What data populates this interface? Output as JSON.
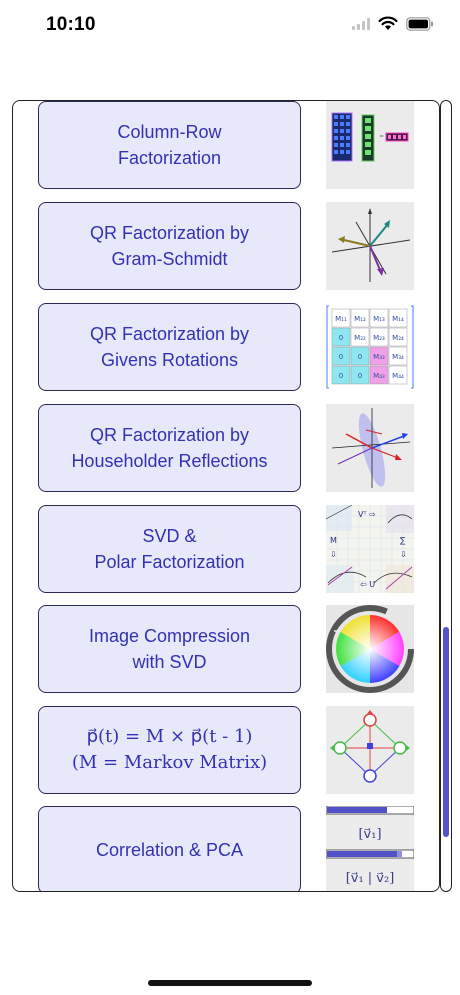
{
  "status_bar": {
    "time": "10:10"
  },
  "items": [
    {
      "label": "Column-Row\nFactorization",
      "icon": "column-row-matrix-icon"
    },
    {
      "label": "QR Factorization by\nGram-Schmidt",
      "icon": "orthogonal-vectors-icon"
    },
    {
      "label": "QR Factorization by\nGivens Rotations",
      "icon": "givens-matrix-icon",
      "matrix": [
        [
          "M₁₁",
          "M₁₂",
          "M₁₃",
          "M₁₄"
        ],
        [
          "0",
          "M₂₂",
          "M₂₃",
          "M₂₄"
        ],
        [
          "0",
          "0",
          "M₃₃",
          "M₃₄"
        ],
        [
          "0",
          "0",
          "M₄₃",
          "M₄₄"
        ]
      ]
    },
    {
      "label": "QR Factorization by\nHouseholder Reflections",
      "icon": "householder-reflection-icon"
    },
    {
      "label": "SVD &\nPolar Factorization",
      "icon": "svd-diagram-icon",
      "labels": {
        "vt": "Vᵀ ⇨",
        "m": "M",
        "sigma": "∑",
        "u": "⇦ U",
        "down1": "⇩",
        "down2": "⇩"
      }
    },
    {
      "label": "Image Compression\nwith SVD",
      "icon": "color-wheel-icon"
    },
    {
      "label": "p⃗(t) = M × p⃗(t - 1)\n(M = Markov Matrix)",
      "icon": "markov-graph-icon"
    },
    {
      "label": "Correlation & PCA",
      "icon": "pca-vectors-icon",
      "labels": {
        "v1": "[v⃗₁]",
        "v1v2": "[v⃗₁ | v⃗₂]"
      }
    }
  ],
  "scrollbar": {
    "position": 0.66
  }
}
